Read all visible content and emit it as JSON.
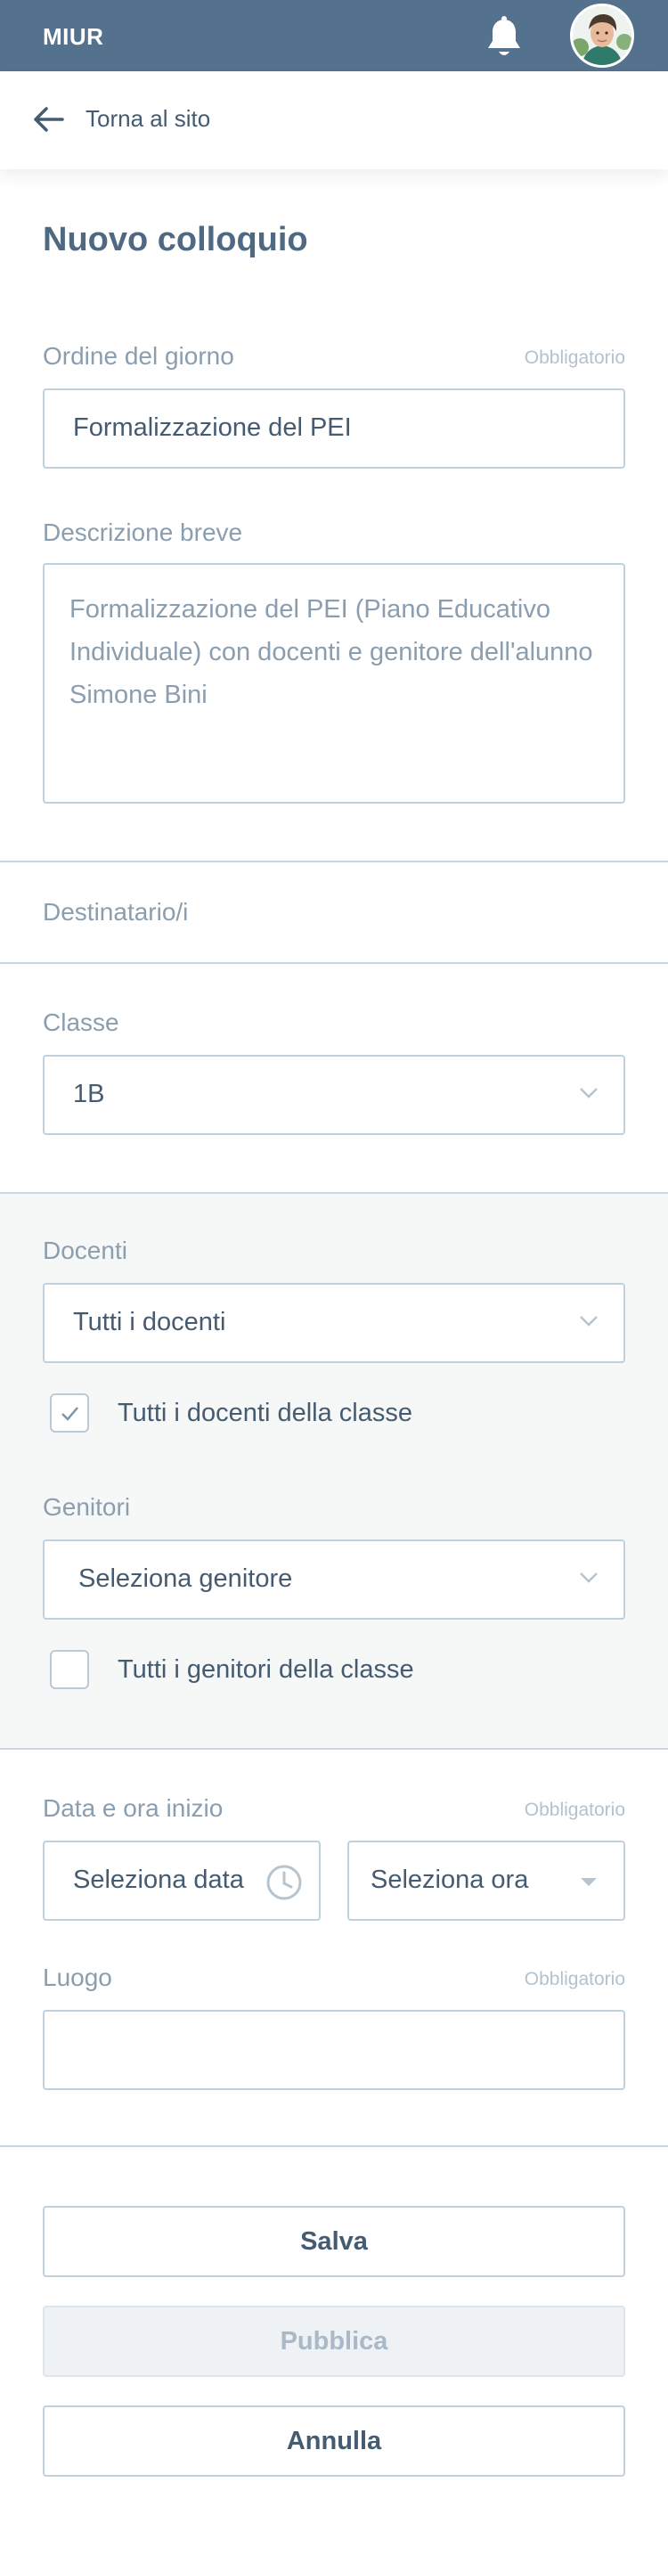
{
  "topbar": {
    "brand": "MIUR",
    "bell_icon": "bell-icon",
    "avatar_icon": "user-avatar"
  },
  "back": {
    "label": "Torna al sito",
    "icon": "arrow-left-icon"
  },
  "page_title": "Nuovo colloquio",
  "agenda": {
    "label": "Ordine del giorno",
    "required": "Obbligatorio",
    "value": "Formalizzazione del PEI"
  },
  "description": {
    "label": "Descrizione breve",
    "value": "Formalizzazione del PEI (Piano Educativo Individuale) con docenti e genitore dell'alunno Simone Bini"
  },
  "recipients": {
    "label": "Destinatario/i"
  },
  "class": {
    "label": "Classe",
    "value": "1B",
    "icon": "chevron-down-icon"
  },
  "teachers": {
    "label": "Docenti",
    "value": "Tutti i docenti",
    "all_label": "Tutti i docenti della classe",
    "all_checked": true
  },
  "parents": {
    "label": "Genitori",
    "value": "Seleziona genitore",
    "all_label": "Tutti i genitori della classe",
    "all_checked": false
  },
  "start": {
    "label": "Data e ora inizio",
    "required": "Obbligatorio",
    "date_value": "Seleziona data",
    "time_value": "Seleziona ora",
    "clock_icon": "clock-icon"
  },
  "place": {
    "label": "Luogo",
    "required": "Obbligatorio",
    "value": ""
  },
  "actions": {
    "save": "Salva",
    "publish": "Pubblica",
    "cancel": "Annulla"
  },
  "colors": {
    "topbar": "#54728d",
    "text": "#455b71",
    "muted": "#8b9eb0",
    "border": "#c0d1de"
  }
}
